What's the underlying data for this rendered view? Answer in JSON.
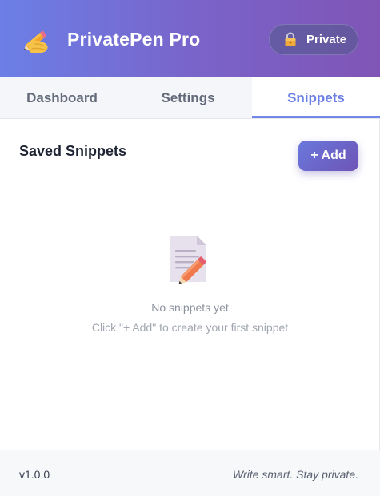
{
  "header": {
    "app_title": "PrivatePen Pro",
    "logo_icon": "writing-hand-icon",
    "badge": {
      "icon": "lock-icon",
      "label": "Private"
    }
  },
  "tabs": [
    {
      "label": "Dashboard",
      "active": false
    },
    {
      "label": "Settings",
      "active": false
    },
    {
      "label": "Snippets",
      "active": true
    }
  ],
  "snippets": {
    "title": "Saved Snippets",
    "add_label": "+ Add",
    "empty_icon": "memo-pencil-icon",
    "empty_title": "No snippets yet",
    "empty_hint": "Click \"+ Add\" to create your first snippet"
  },
  "footer": {
    "version": "v1.0.0",
    "tagline": "Write smart. Stay private."
  },
  "colors": {
    "header_gradient_start": "#6b7fe6",
    "header_gradient_end": "#8055b6",
    "active_tab": "#6d80e6",
    "button_gradient_start": "#6a78dc",
    "button_gradient_end": "#6e54b6"
  }
}
